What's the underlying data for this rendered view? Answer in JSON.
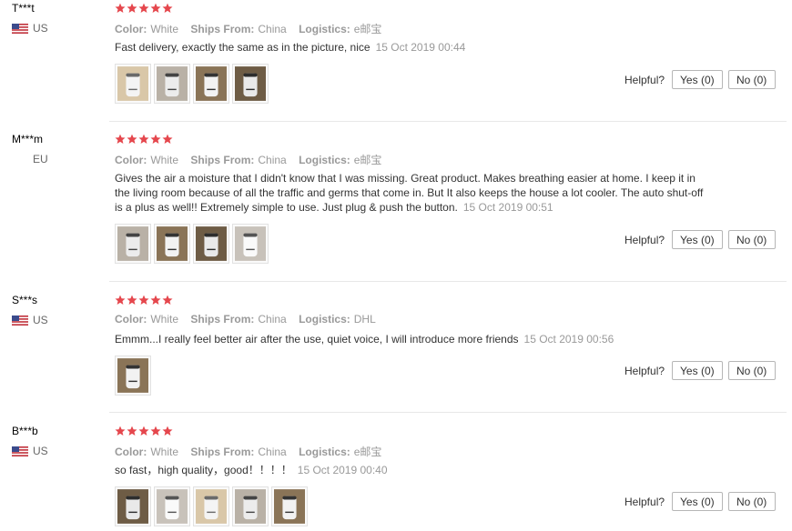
{
  "labels": {
    "color": "Color:",
    "ships_from": "Ships From:",
    "logistics": "Logistics:",
    "helpful": "Helpful?"
  },
  "colors": {
    "star": "#e5474d",
    "separator": "#e8e8e8"
  },
  "icons": {
    "star": "star-icon",
    "flag_us": "us-flag-icon"
  },
  "reviews": [
    {
      "user": "T***t",
      "country": "US",
      "rating": 5,
      "color": "White",
      "ships_from": "China",
      "logistics": "e邮宝",
      "text": "Fast delivery, exactly the same as in the picture, nice",
      "date": "15 Oct 2019 00:44",
      "yes": "Yes (0)",
      "no": "No (0)",
      "photo_count": 4
    },
    {
      "user": "M***m",
      "country": "EU",
      "rating": 5,
      "color": "White",
      "ships_from": "China",
      "logistics": "e邮宝",
      "text": "Gives the air a moisture that I didn't know that I was missing. Great product. Makes breathing easier at home. I keep it in the living room because of all the traffic and germs that come in. But It also keeps the house a lot cooler. The auto shut-off is a plus as well!! Extremely simple to use. Just plug & push the button.",
      "date": "15 Oct 2019 00:51",
      "yes": "Yes (0)",
      "no": "No (0)",
      "photo_count": 4
    },
    {
      "user": "S***s",
      "country": "US",
      "rating": 5,
      "color": "White",
      "ships_from": "China",
      "logistics": "DHL",
      "text": "Emmm...I really feel better air after the use, quiet voice, I will introduce more friends",
      "date": "15 Oct 2019 00:56",
      "yes": "Yes (0)",
      "no": "No (0)",
      "photo_count": 1
    },
    {
      "user": "B***b",
      "country": "US",
      "rating": 5,
      "color": "White",
      "ships_from": "China",
      "logistics": "e邮宝",
      "text": "so fast，high quality，good！！！！",
      "date": "15 Oct 2019 00:40",
      "yes": "Yes (0)",
      "no": "No (0)",
      "photo_count": 5
    }
  ]
}
